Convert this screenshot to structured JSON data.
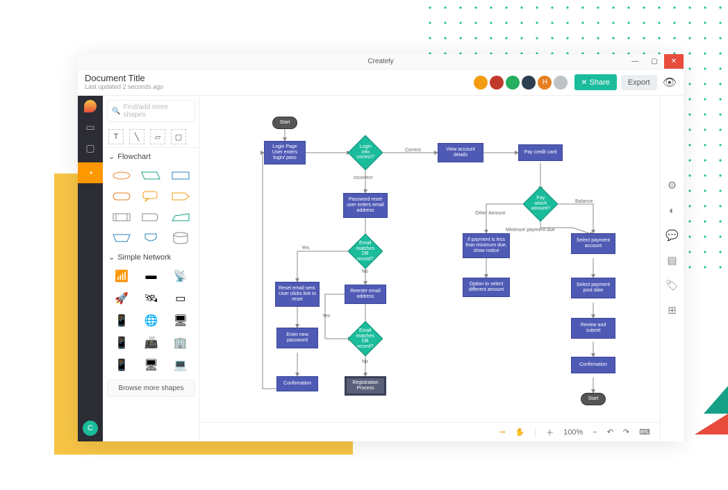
{
  "window": {
    "app_title": "Creately",
    "close": "✕",
    "minimize": "—",
    "maximize": "▢"
  },
  "header": {
    "doc_title": "Document Title",
    "doc_subtitle": "Last updated 2 seconds ago",
    "share_label": "Share",
    "export_label": "Export"
  },
  "avatars": [
    {
      "letter": "",
      "bg": "#f39c12"
    },
    {
      "letter": "",
      "bg": "#c0392b"
    },
    {
      "letter": "",
      "bg": "#27ae60"
    },
    {
      "letter": "",
      "bg": "#2c3e50"
    },
    {
      "letter": "H",
      "bg": "#e67e22"
    },
    {
      "letter": "",
      "bg": "#bdc3c7"
    }
  ],
  "rail_user": "C",
  "search_placeholder": "Find/add more shapes",
  "sections": {
    "flowchart": "Flowchart",
    "network": "Simple Network"
  },
  "browse_more": "Browse more shapes",
  "zoom": "100%",
  "flow": {
    "start": "Start",
    "login_page": "Login Page User enters login/ pass",
    "login_correct": "Login info correct?",
    "correct_lbl": "Correct",
    "incorrect_lbl": "Incorrect",
    "view_account": "View account details",
    "pay_credit": "Pay credit card",
    "pwd_reset": "Password reset user enters email address",
    "email_matches1": "Email matches DB record?",
    "yes1": "Yes",
    "no1": "No",
    "reset_sent": "Reset email sent. User clicks link to reset",
    "reenter_email": "Reenter email address",
    "yes2": "Yes",
    "email_matches2": "Email matches DB record?",
    "no2": "No",
    "enter_new_pwd": "Enter new password",
    "registration": "Registration Process",
    "confirmation1": "Confirmation",
    "pay_which": "Pay which amount?",
    "balance_lbl": "Balance",
    "other_amount_lbl": "Other Amount",
    "min_due_lbl": "Minimum payment due",
    "if_payment_less": "If payment is less than minimum due, show notice",
    "option_select": "Option to select different amount",
    "select_account": "Select payment account",
    "select_post_date": "Select payment post date",
    "review_submit": "Review and submit",
    "confirmation2": "Confirmation",
    "end_start": "Start"
  }
}
